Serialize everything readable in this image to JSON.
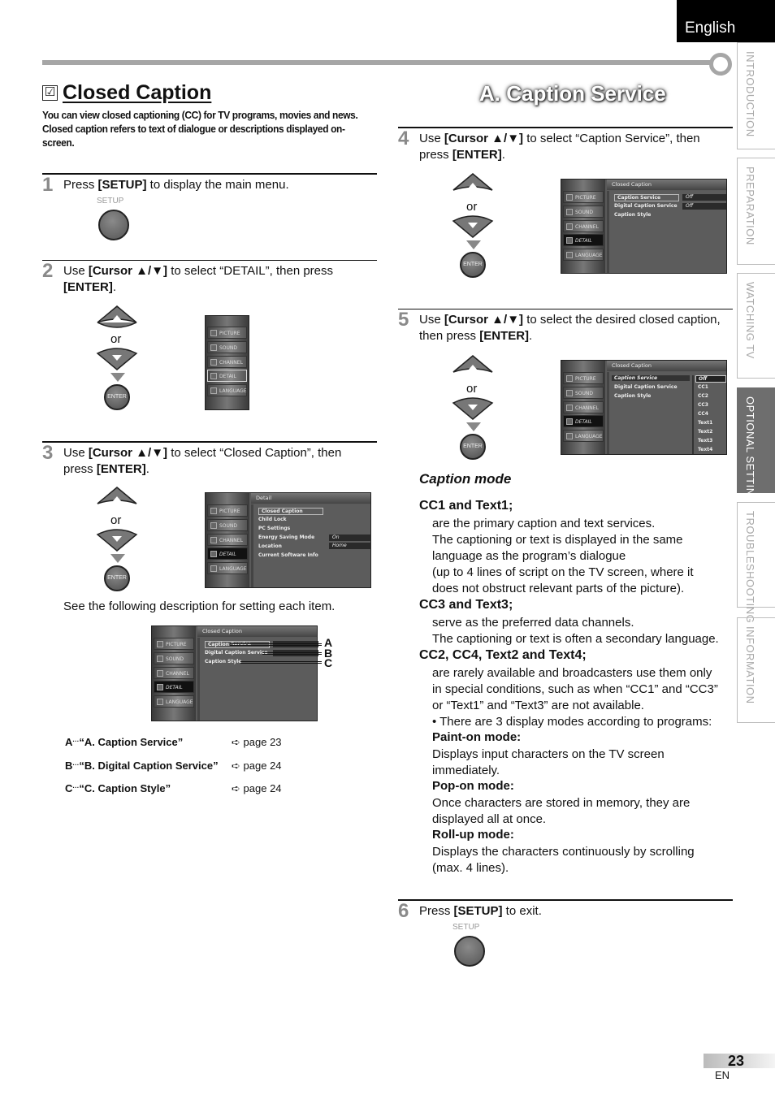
{
  "header": {
    "language": "English"
  },
  "side_tabs": [
    {
      "label": "INTRODUCTION",
      "active": false
    },
    {
      "label": "PREPARATION",
      "active": false
    },
    {
      "label": "WATCHING  TV",
      "active": false
    },
    {
      "label": "OPTIONAL  SETTING",
      "active": true
    },
    {
      "label": "TROUBLESHOOTING",
      "active": false
    },
    {
      "label": "INFORMATION",
      "active": false
    }
  ],
  "left": {
    "title": "Closed Caption",
    "check_glyph": "☑",
    "intro": "You can view closed captioning (CC) for TV programs, movies and news. Closed caption refers to text of dialogue or descriptions displayed on-screen.",
    "step1": {
      "num": "1",
      "pre": "Press ",
      "key": "[SETUP]",
      "post": " to display the main menu.",
      "button_label": "SETUP"
    },
    "step2": {
      "num": "2",
      "pre": "Use ",
      "key": "[Cursor ▲/▼]",
      "mid": " to select “DETAIL”, then press ",
      "key2": "[ENTER]",
      "post": "."
    },
    "step3": {
      "num": "3",
      "pre": "Use ",
      "key": "[Cursor ▲/▼]",
      "mid": " to select “Closed Caption”, then press ",
      "key2": "[ENTER]",
      "post": "."
    },
    "see_desc": "See the following description for setting each item.",
    "refs": [
      {
        "letter": "A",
        "dots": "···",
        "label": "“A. Caption Service”",
        "arrow": "➪",
        "page": "page 23"
      },
      {
        "letter": "B",
        "dots": "···",
        "label": "“B. Digital Caption Service”",
        "arrow": "➪",
        "page": "page 24"
      },
      {
        "letter": "C",
        "dots": "···",
        "label": "“C. Caption Style”",
        "arrow": "➪",
        "page": "page 24"
      }
    ],
    "callouts": [
      "A",
      "B",
      "C"
    ]
  },
  "controls": {
    "or": "or",
    "enter": "ENTER"
  },
  "tv_menu": {
    "side_items": [
      "PICTURE",
      "SOUND",
      "CHANNEL",
      "DETAIL",
      "LANGUAGE"
    ],
    "detail_header": "Detail",
    "detail_items": [
      "Closed Caption",
      "Child Lock",
      "PC Settings",
      "Energy Saving Mode",
      "Location",
      "Current Software Info"
    ],
    "detail_values": {
      "energy": "On",
      "location": "Home"
    },
    "cc_header": "Closed Caption",
    "cc_items": [
      "Caption Service",
      "Digital Caption Service",
      "Caption Style"
    ],
    "cc_values": [
      "Off",
      "Off"
    ],
    "cc_options": [
      "Off",
      "CC1",
      "CC2",
      "CC3",
      "CC4",
      "Text1",
      "Text2",
      "Text3",
      "Text4"
    ]
  },
  "right": {
    "section_title": "A.  Caption Service",
    "step4": {
      "num": "4",
      "pre": "Use ",
      "key": "[Cursor ▲/▼]",
      "mid": " to select “Caption Service”, then press ",
      "key2": "[ENTER]",
      "post": "."
    },
    "step5": {
      "num": "5",
      "pre": "Use ",
      "key": "[Cursor ▲/▼]",
      "mid": " to select the desired closed caption, then press ",
      "key2": "[ENTER]",
      "post": "."
    },
    "caption_mode": {
      "title": "Caption mode",
      "cc1_head": "CC1 and Text1;",
      "cc1_body": [
        "are the primary caption and text services.",
        "The captioning or text is displayed in the same",
        "language as the program’s dialogue",
        "(up to 4 lines of script on the TV screen, where it",
        "does not obstruct relevant parts of the picture)."
      ],
      "cc3_head": "CC3 and Text3;",
      "cc3_body": [
        "serve as the preferred data channels.",
        "The captioning or text is often a secondary language."
      ],
      "cc2_head": "CC2, CC4, Text2 and Text4;",
      "cc2_body": [
        "are rarely available and broadcasters use them only",
        "in special conditions, such as when “CC1” and “CC3”",
        "or “Text1” and “Text3” are not available."
      ],
      "bullet": "•  There are 3 display modes according to programs:",
      "modes": [
        {
          "name": "Paint-on mode:",
          "desc": [
            "Displays input characters on the TV screen",
            "immediately."
          ]
        },
        {
          "name": "Pop-on mode:",
          "desc": [
            "Once characters are stored in memory, they are",
            "displayed all at once."
          ]
        },
        {
          "name": "Roll-up mode:",
          "desc": [
            "Displays the characters continuously by scrolling",
            "(max. 4 lines)."
          ]
        }
      ]
    },
    "step6": {
      "num": "6",
      "pre": "Press ",
      "key": "[SETUP]",
      "post": " to exit.",
      "button_label": "SETUP"
    }
  },
  "footer": {
    "page": "23",
    "lang_code": "EN"
  }
}
